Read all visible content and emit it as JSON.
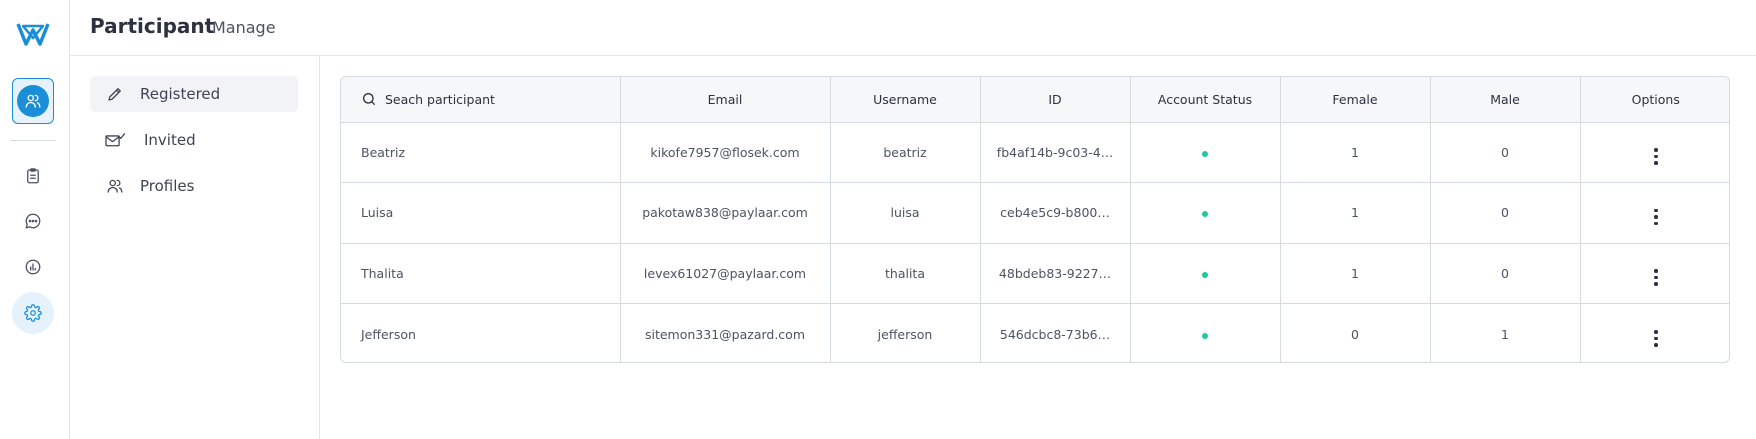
{
  "header": {
    "title": "Participant",
    "subtitle": "Manage"
  },
  "rail": {
    "items": [
      {
        "icon": "users-icon",
        "active": true
      },
      {
        "icon": "clipboard-icon"
      },
      {
        "icon": "chat-icon"
      },
      {
        "icon": "chart-icon"
      },
      {
        "icon": "gear-icon",
        "highlighted": true
      }
    ],
    "accent": "#1a8fd8"
  },
  "subnav": {
    "items": [
      {
        "label": "Registered",
        "icon": "pencil-icon",
        "active": true
      },
      {
        "label": "Invited",
        "icon": "mail-check-icon"
      },
      {
        "label": "Profiles",
        "icon": "users-icon"
      }
    ]
  },
  "table": {
    "search_placeholder": "Seach participant",
    "columns": [
      "Email",
      "Username",
      "ID",
      "Account Status",
      "Female",
      "Male",
      "Options"
    ],
    "rows": [
      {
        "name": "Beatriz",
        "email": "kikofe7957@flosek.com",
        "username": "beatriz",
        "id": "fb4af14b-9c03-4…",
        "female": "1",
        "male": "0"
      },
      {
        "name": "Luisa",
        "email": "pakotaw838@paylaar.com",
        "username": "luisa",
        "id": "ceb4e5c9-b800…",
        "female": "1",
        "male": "0"
      },
      {
        "name": "Thalita",
        "email": "levex61027@paylaar.com",
        "username": "thalita",
        "id": "48bdeb83-9227…",
        "female": "1",
        "male": "0"
      },
      {
        "name": "Jefferson",
        "email": "sitemon331@pazard.com",
        "username": "jefferson",
        "id": "546dcbc8-73b6…",
        "female": "0",
        "male": "1"
      }
    ],
    "status_color": "#1fc8a0"
  }
}
